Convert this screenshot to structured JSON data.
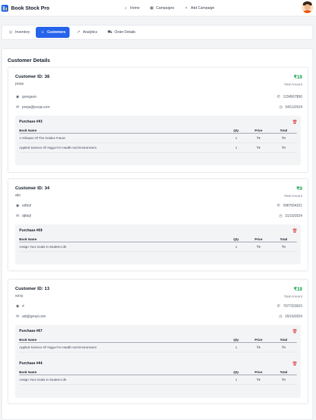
{
  "app": {
    "title": "Book Stock Pro"
  },
  "nav": [
    {
      "label": "Home",
      "icon": "home-icon"
    },
    {
      "label": "Campaigns",
      "icon": "calendar-icon"
    },
    {
      "label": "Add Campaign",
      "icon": "plus-icon"
    }
  ],
  "tabs": [
    {
      "label": "Inventory",
      "icon": "box-icon",
      "active": false
    },
    {
      "label": "Customers",
      "icon": "users-icon",
      "active": true
    },
    {
      "label": "Analytics",
      "icon": "trend-icon",
      "active": false
    },
    {
      "label": "Order Details",
      "icon": "cart-icon",
      "active": false
    }
  ],
  "page": {
    "title": "Customer Details"
  },
  "labels": {
    "total_amount": "Total Amount",
    "book_name": "Book Name",
    "qty": "Qty",
    "price": "Price",
    "total": "Total"
  },
  "customers": [
    {
      "id": "Customer ID: 38",
      "name": "pooja",
      "amount": "₹18",
      "location": "goregaon",
      "phone": "123456789​0",
      "email": "pooja@pooja.com",
      "date": "04/11/2024",
      "purchases": [
        {
          "title": "Purchase #43",
          "items": [
            {
              "book": "A Glimpse Of The Golden Future",
              "qty": "1",
              "price": "₹9",
              "total": "₹9"
            },
            {
              "book": "Applied Science Of Yagya For Health And Environment",
              "qty": "1",
              "price": "₹9",
              "total": "₹9"
            }
          ]
        }
      ]
    },
    {
      "id": "Customer ID: 34",
      "name": "abc",
      "amount": "₹9",
      "location": "sdfdsf",
      "phone": "0987654321",
      "email": "djfdsjf",
      "date": "31/10/2024",
      "purchases": [
        {
          "title": "Purchase #69",
          "items": [
            {
              "book": "Assign Your Goals In Student Life",
              "qty": "1",
              "price": "₹9",
              "total": "₹9"
            }
          ]
        }
      ]
    },
    {
      "id": "Customer ID: 13",
      "name": "suraj",
      "amount": "₹18",
      "location": "d",
      "phone": "7977323923",
      "email": "adi@gmail.com",
      "date": "29/10/2024",
      "purchases": [
        {
          "title": "Purchase #67",
          "items": [
            {
              "book": "Applied Science Of Yagya For Health And Environment",
              "qty": "1",
              "price": "₹9",
              "total": "₹9"
            }
          ]
        },
        {
          "title": "Purchase #44",
          "items": [
            {
              "book": "Assign Your Goals In Student Life",
              "qty": "1",
              "price": "₹9",
              "total": "₹9"
            }
          ]
        }
      ]
    }
  ]
}
